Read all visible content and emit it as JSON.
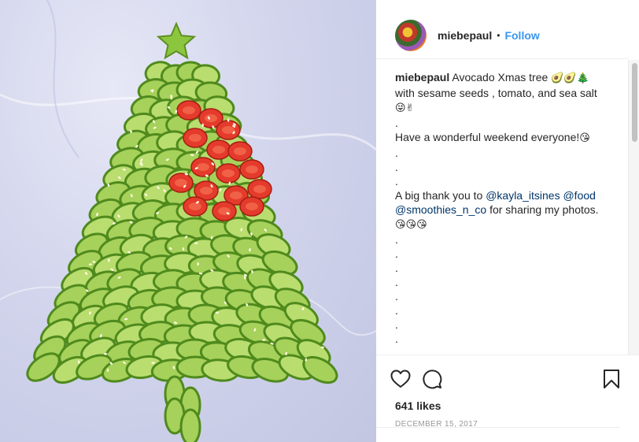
{
  "post": {
    "username": "miebepaul",
    "separator": "•",
    "follow_label": "Follow",
    "caption_text": "Avocado Xmas tree",
    "caption_emoji_1": "🥑🥑🎄",
    "caption_line2": "with sesame seeds , tomato, and sea salt",
    "caption_emoji_2": "😜✌",
    "dot": ".",
    "weekend_text": "Have a wonderful weekend everyone!",
    "weekend_emoji": "😘",
    "thanks_text": "A big thank you to",
    "mention_1": "@kayla_itsines",
    "mention_2": "@food",
    "mention_3": "@smoothies_n_co",
    "sharing_text": "for sharing my photos.",
    "thanks_emoji": "😘😘😘",
    "likes": "641 likes",
    "date": "December 15, 2017"
  },
  "icons": {
    "like": "heart-icon",
    "comment": "comment-icon",
    "save": "bookmark-icon"
  },
  "colors": {
    "link": "#3897f0",
    "mention": "#003569",
    "avocado": "#8cc63f",
    "tomato": "#e53b2c"
  }
}
